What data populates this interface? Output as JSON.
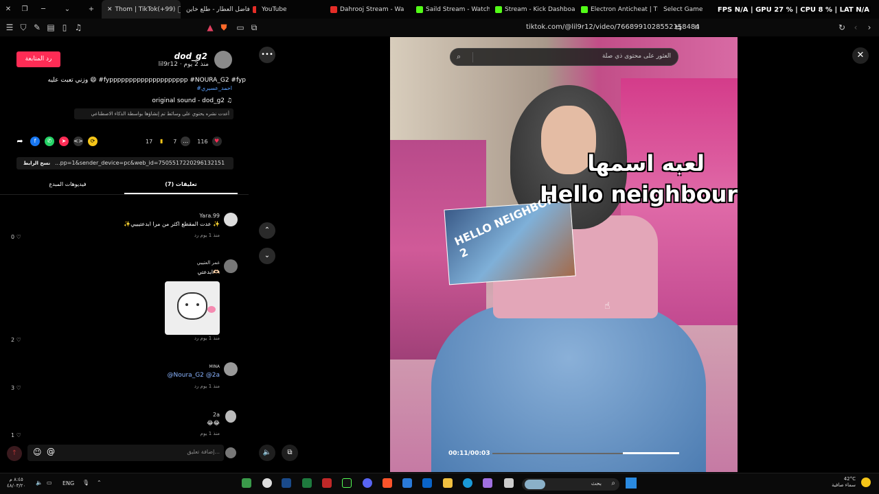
{
  "browser": {
    "tabs": [
      {
        "label": "Thom | TikTok(+99)"
      },
      {
        "label": "فاضل العطار - طلع خاين"
      },
      {
        "label": "YouTube"
      },
      {
        "label": "Dahrooj Stream - Wa"
      },
      {
        "label": "Saild Stream - Watch"
      },
      {
        "label": "Stream - Kick Dashboard"
      },
      {
        "label": "Electron Anticheat | The"
      },
      {
        "label": "Select Game"
      }
    ],
    "url": "tiktok.com/@lil9r12/video/7668991028552158484",
    "stats_overlay": "FPS N/A | GPU 27 % | CPU 8 % | LAT N/A"
  },
  "post": {
    "follow_label": "رد المتابعة",
    "username": "dod_g2",
    "handle": "lil9r12 · منذ 2 يوم",
    "description": "وزني تعبت عليه 😄 #fypppppppppppppppppppp #NOURA_G2 #fyp",
    "hashtag2": "#احمد_عسيري",
    "sound": "original sound - dod_g2",
    "ai_note": "أعدت نشره   يحتوي على وسائط تم إنشاؤها بواسطة الذكاء الاصطناعي",
    "likes": "116",
    "comments_count": "7",
    "saves": "17",
    "link": "...pp=1&sender_device=pc&web_id=7505517220296132151",
    "copy_link": "نسخ الرابط"
  },
  "tabs": {
    "comments": "تعليقات (7)",
    "creator_videos": "فيديوهات المبدع"
  },
  "comments": [
    {
      "name": "Yara.99",
      "text": "✨عدت المقطع اكثر من مرا ابدعتيييي ✨",
      "meta": "منذ 1 يوم   رد",
      "likes": "0"
    },
    {
      "name": "غمر العتيبي",
      "text": "ابدعتي🫶🏻",
      "meta": "منذ 1 يوم   رد",
      "likes": "2"
    },
    {
      "name": "MINA",
      "text": "@Noura_G2 @2a",
      "meta": "منذ 1 يوم   رد",
      "likes": "3"
    },
    {
      "name": "2a",
      "text": "😂😂",
      "meta": "منذ 1 يوم",
      "likes": "1"
    }
  ],
  "reply_placeholder": "إضافة تعليق...",
  "video": {
    "search_placeholder": "العثور على محتوى ذي صلة",
    "overlay_ar": "لعبه اسمها",
    "overlay_en": "Hello neighbour",
    "hn_title": "HELLO NEIGHBOR 2",
    "time": "00:11/00:03",
    "progress": 0.3
  },
  "taskbar": {
    "lang": "ENG",
    "clock_time": "٨:٤٥ م",
    "clock_date": "٤٨/٠٣/٢٠",
    "temp": "42°C",
    "weather": "سماء صافية",
    "search": "بحث"
  }
}
